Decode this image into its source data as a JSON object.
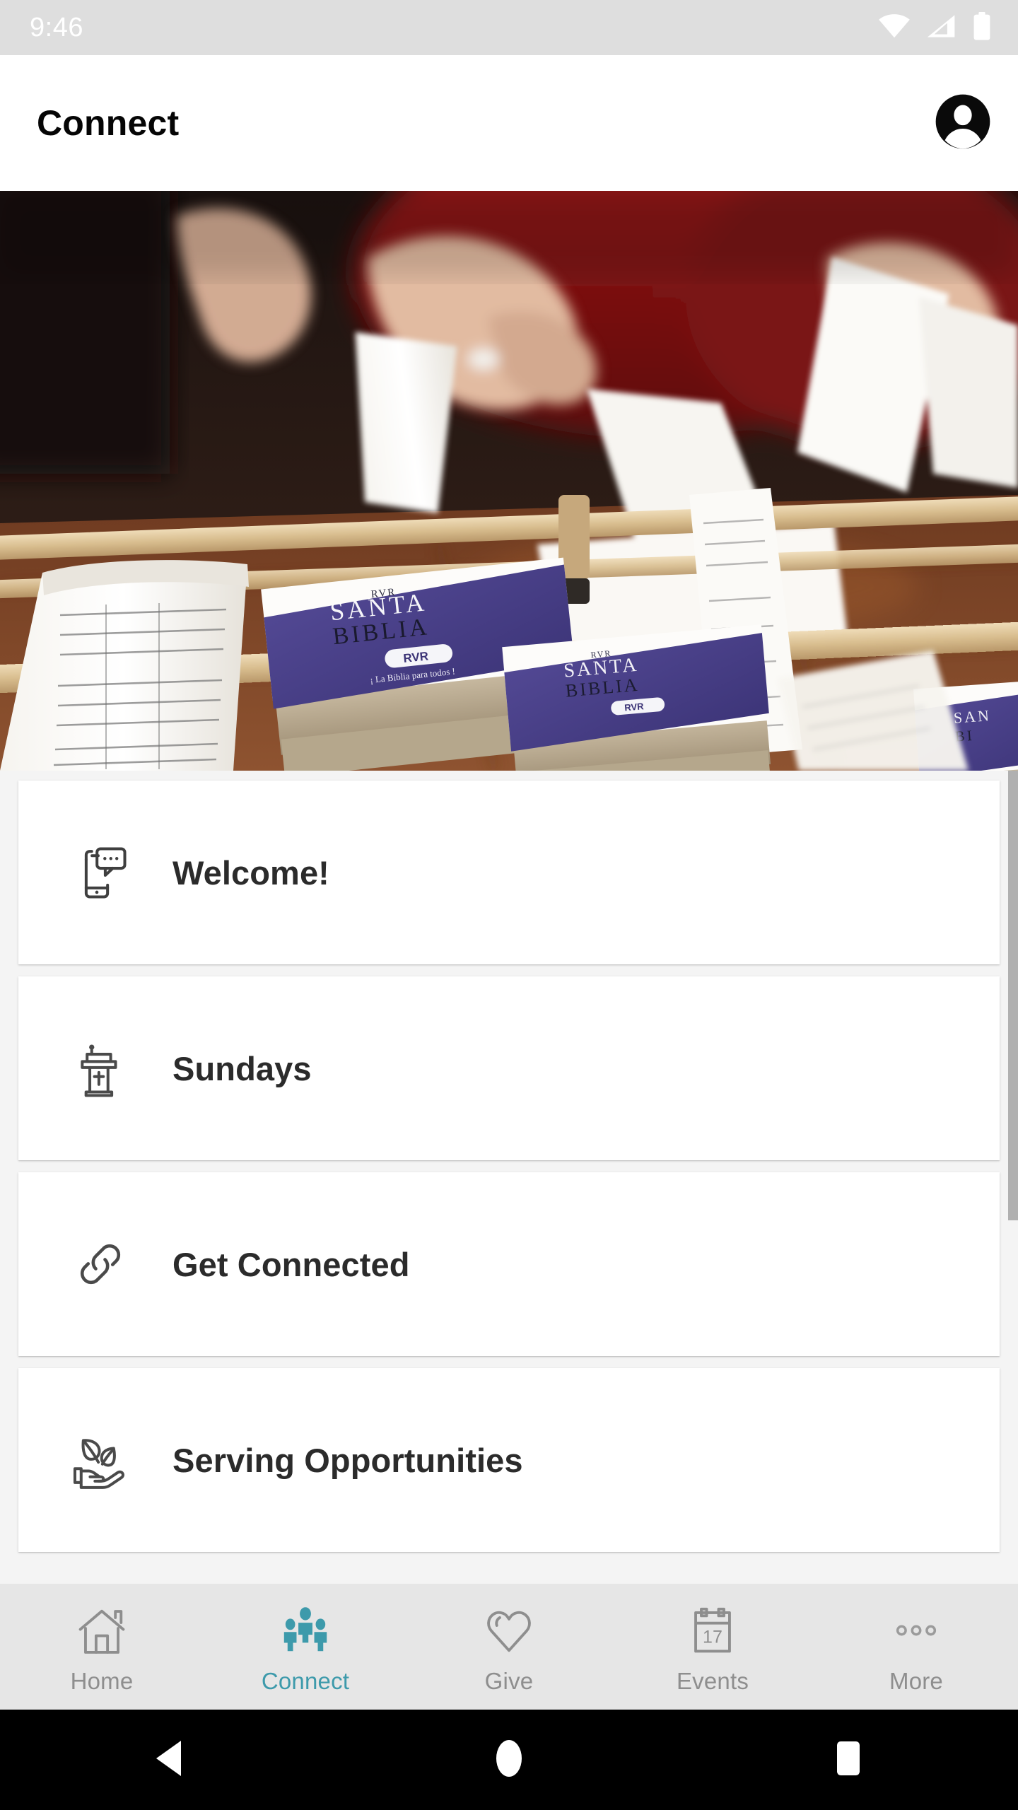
{
  "status_bar": {
    "time": "9:46",
    "icons": [
      "wifi-icon",
      "cellular-signal-icon",
      "battery-icon"
    ],
    "background": "#dedede",
    "foreground": "#ffffff"
  },
  "app_bar": {
    "title": "Connect",
    "profile_icon": "account-avatar-icon"
  },
  "hero": {
    "alt": "Hands assembling RVR Santa Biblia Spanish Bibles with long printed paper strips draped over wooden dowels on a wood table",
    "book_title_line1": "RVR",
    "book_title_line2": "SANTA",
    "book_title_line3": "BIBLIA",
    "book_imprint": "RVR",
    "book_tagline": "¡ La Biblia para todos !",
    "cover_color": "#4b4089",
    "table_color": "#8a4b2a"
  },
  "list": {
    "items": [
      {
        "label": "Welcome!",
        "icon": "phone-chat-bubble-icon"
      },
      {
        "label": "Sundays",
        "icon": "pulpit-cross-icon"
      },
      {
        "label": "Get Connected",
        "icon": "chain-link-icon"
      },
      {
        "label": "Serving Opportunities",
        "icon": "hand-holding-leaves-icon"
      }
    ]
  },
  "scrollbar": {
    "visible": true,
    "color": "#b0b0b0"
  },
  "tab_bar": {
    "active_color": "#3d9aab",
    "inactive_color": "#8e8e8e",
    "background": "#e6e6e6",
    "tabs": [
      {
        "label": "Home",
        "icon": "home-house-icon",
        "active": false
      },
      {
        "label": "Connect",
        "icon": "people-group-icon",
        "active": true
      },
      {
        "label": "Give",
        "icon": "heart-outline-icon",
        "active": false
      },
      {
        "label": "Events",
        "icon": "calendar-icon",
        "active": false,
        "badge": "17"
      },
      {
        "label": "More",
        "icon": "three-dots-icon",
        "active": false
      }
    ]
  },
  "system_nav": {
    "buttons": [
      {
        "name": "back-button",
        "icon": "triangle-left-icon"
      },
      {
        "name": "home-button",
        "icon": "circle-icon"
      },
      {
        "name": "recents-button",
        "icon": "square-icon"
      }
    ]
  }
}
